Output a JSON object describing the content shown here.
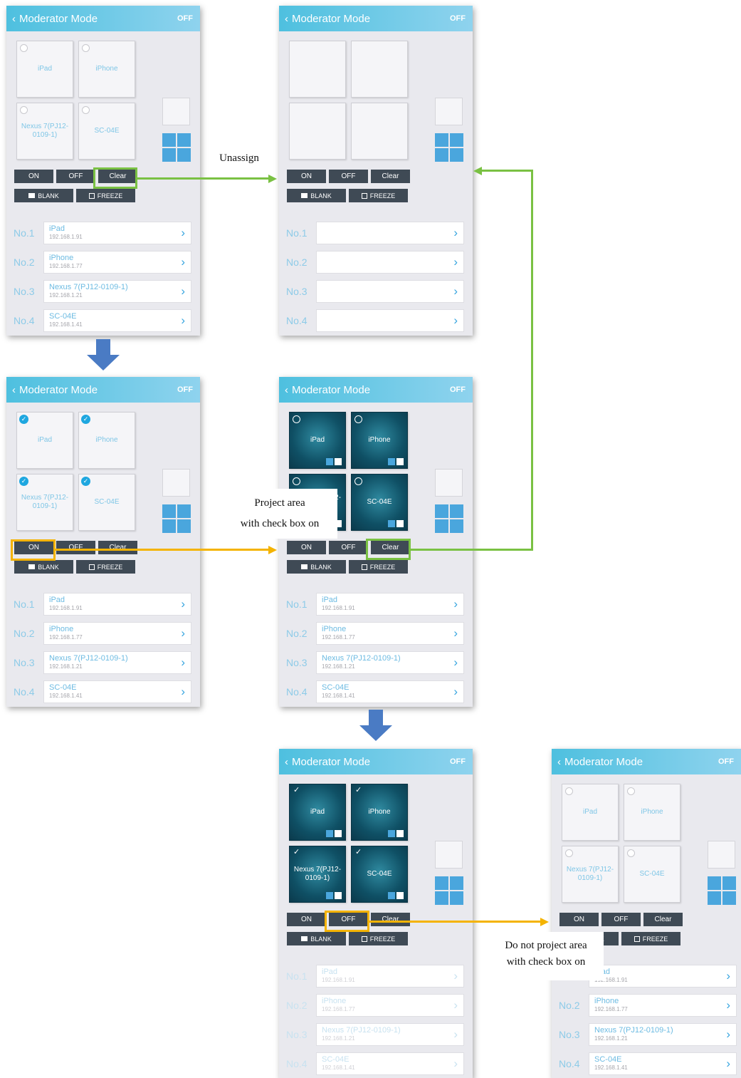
{
  "header": {
    "title": "Moderator Mode",
    "status": "OFF"
  },
  "buttons": {
    "on": "ON",
    "off": "OFF",
    "clear": "Clear",
    "blank": "BLANK",
    "freeze": "FREEZE"
  },
  "tiles": {
    "t0": "iPad",
    "t1": "iPhone",
    "t2": "Nexus 7(PJ12-0109-1)",
    "t3": "SC-04E"
  },
  "list": {
    "no": [
      "No.1",
      "No.2",
      "No.3",
      "No.4"
    ],
    "names": [
      "iPad",
      "iPhone",
      "Nexus 7(PJ12-0109-1)",
      "SC-04E"
    ],
    "ips": [
      "192.168.1.91",
      "192.168.1.77",
      "192.168.1.21",
      "192.168.1.41"
    ]
  },
  "annotations": {
    "unassign": "Unassign",
    "project_line1": "Project area",
    "project_line2": "with check box on",
    "noproject_line1": "Do not project area",
    "noproject_line2": "with check box on"
  },
  "colors": {
    "header": "#4ec0df",
    "button": "#3f4a55",
    "green_arrow": "#7ac143",
    "orange_arrow": "#f4b300",
    "flow_arrow": "#4a7bc4",
    "tile_accent": "#4aa6dd"
  }
}
